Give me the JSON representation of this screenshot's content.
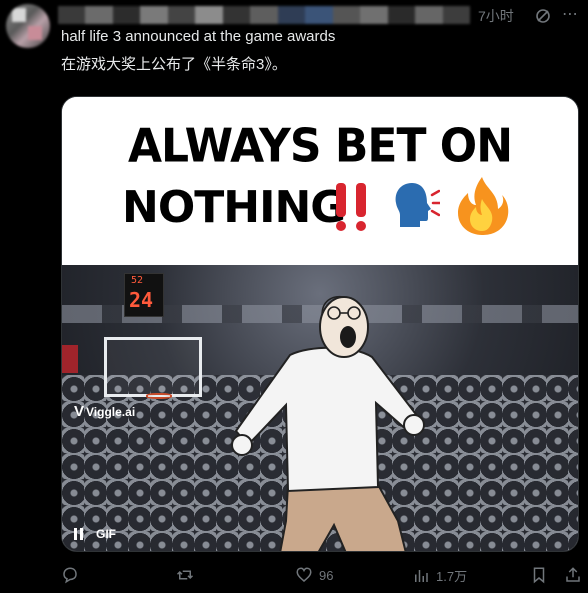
{
  "post": {
    "time": "7小时",
    "text_en": "half life 3 announced at the game awards",
    "text_zh": "在游戏大奖上公布了《半条命3》。"
  },
  "media": {
    "caption_line1": "ALWAYS BET ON",
    "caption_line2": "NOTHING",
    "watermark": "Viggle.ai",
    "shot_clock_top": "52",
    "shot_clock_value": "24",
    "gif_badge": "GIF"
  },
  "actions": {
    "reply_count": "",
    "repost_count": "",
    "like_count": "96",
    "views_count": "1.7万"
  },
  "colors": {
    "background": "#000000",
    "text": "#e7e9ea",
    "muted": "#71767b"
  },
  "icons": [
    "reply-icon",
    "repost-icon",
    "like-icon",
    "views-icon",
    "bookmark-icon",
    "share-icon",
    "grok-icon",
    "more-icon",
    "pause-icon"
  ]
}
